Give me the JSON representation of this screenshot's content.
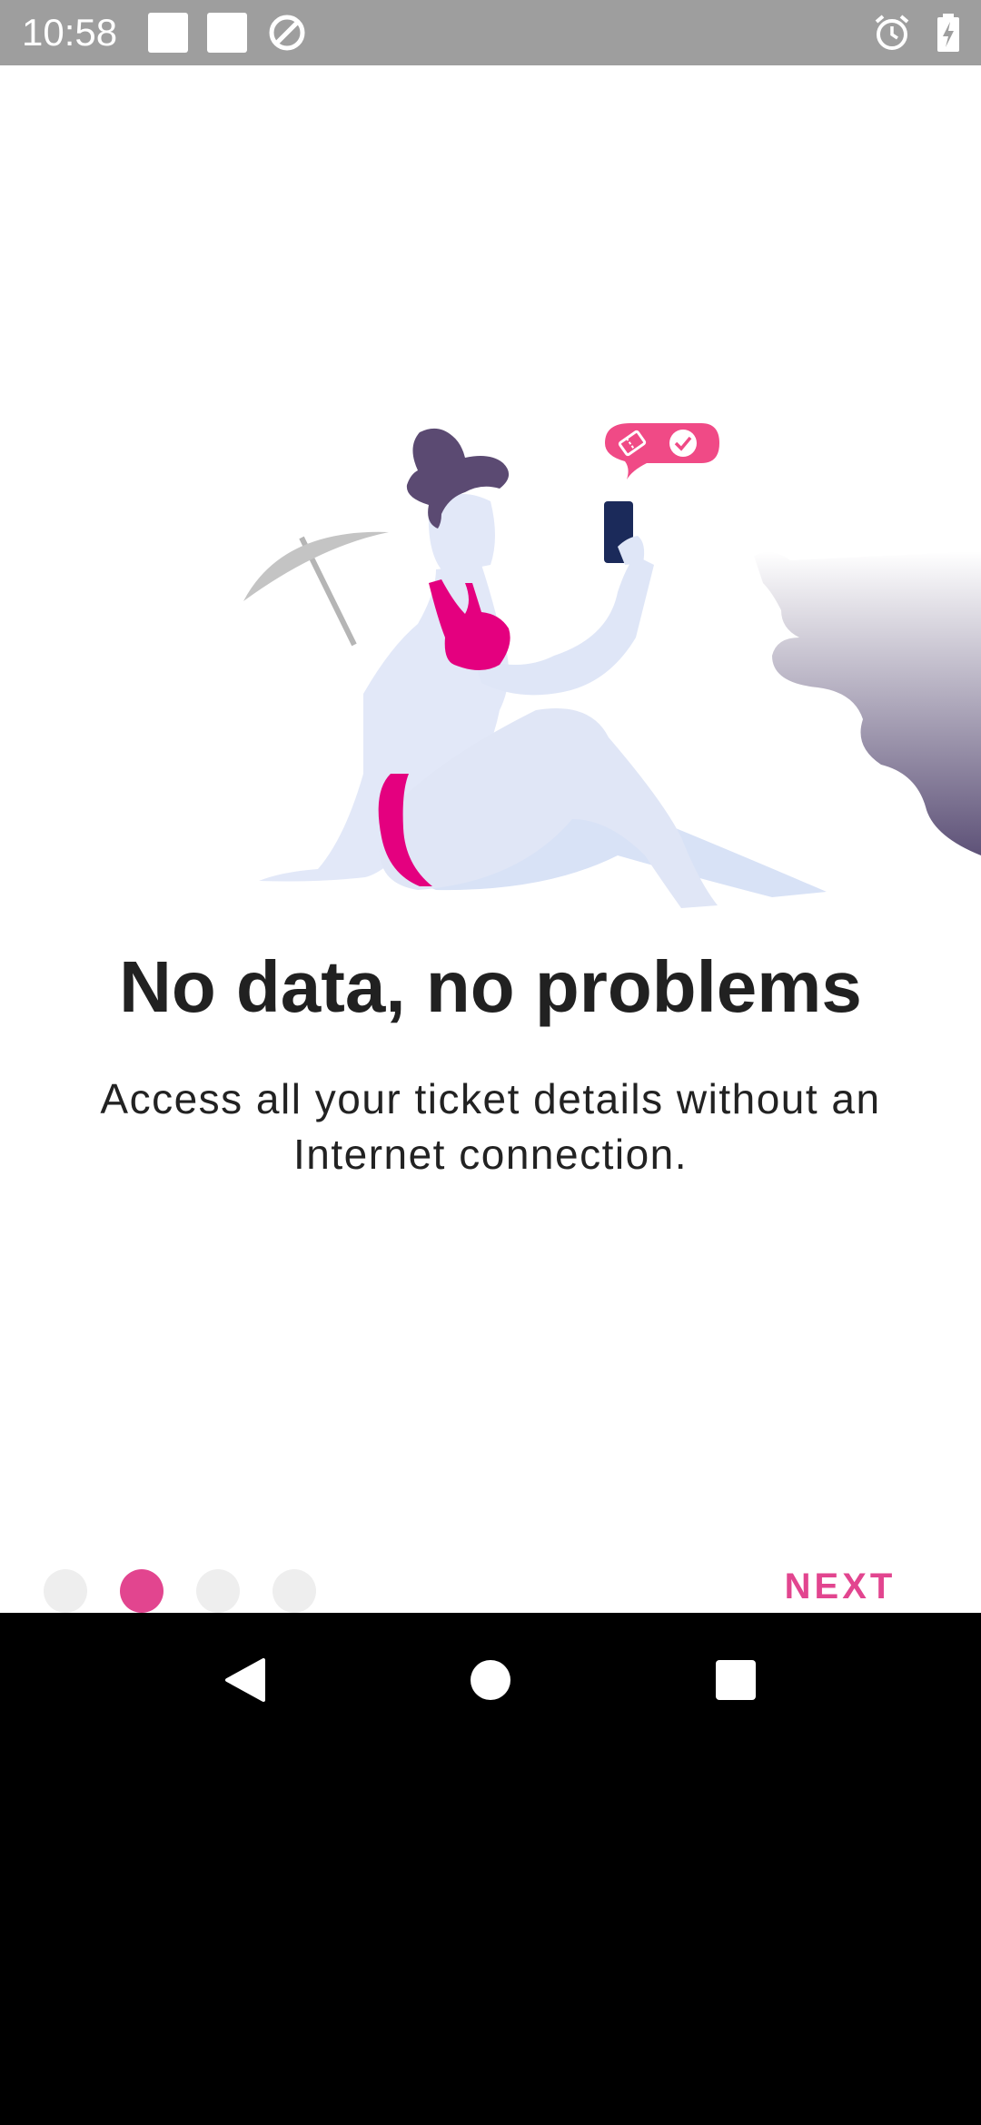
{
  "status_bar": {
    "time": "10:58",
    "left_icons": [
      "notification-square-icon",
      "notification-square-icon",
      "data-saver-icon"
    ],
    "right_icons": [
      "alarm-icon",
      "battery-charging-icon"
    ],
    "background": "#9e9e9e"
  },
  "onboarding": {
    "title": "No data, no problems",
    "description": "Access all your ticket details without an Internet connection.",
    "page_indicator": {
      "total": 4,
      "active_index": 1
    },
    "next_label": "NEXT",
    "accent_color": "#e2458f",
    "illustration": "woman-on-beach-with-phone-ticket-illustration"
  },
  "nav_bar": {
    "buttons": [
      "back-icon",
      "home-icon",
      "recents-icon"
    ]
  }
}
